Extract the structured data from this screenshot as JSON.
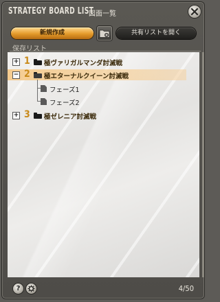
{
  "window": {
    "title_en": "STRATEGY BOARD LIST",
    "title_jp": "図面一覧"
  },
  "toolbar": {
    "new_label": "新規作成",
    "share_label": "共有リストを開く"
  },
  "section": {
    "label": "保存リスト"
  },
  "tree": [
    {
      "number": "1",
      "label": "極ヴァリガルマンダ討滅戦",
      "expanded": false,
      "selected": false
    },
    {
      "number": "2",
      "label": "極エターナルクイーン討滅戦",
      "expanded": true,
      "selected": true,
      "children": [
        {
          "label": "フェーズ1"
        },
        {
          "label": "フェーズ2"
        }
      ]
    },
    {
      "number": "3",
      "label": "極ゼレニア討滅戦",
      "expanded": false,
      "selected": false
    }
  ],
  "footer": {
    "count": "4/50",
    "help_label": "?"
  },
  "colors": {
    "accent_orange": "#e39a2a",
    "selected_row": "#f6c680",
    "number_gold": "#c98a1a"
  }
}
